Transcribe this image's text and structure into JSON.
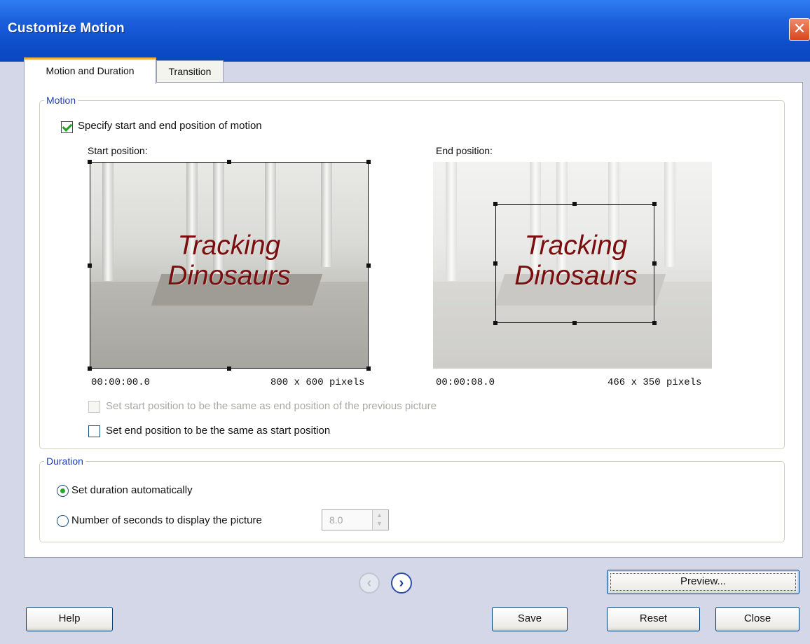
{
  "window": {
    "title": "Customize Motion",
    "close_glyph": "✕"
  },
  "tabs": [
    {
      "label": "Motion and Duration",
      "active": true
    },
    {
      "label": "Transition",
      "active": false
    }
  ],
  "motion": {
    "legend": "Motion",
    "specify_label": "Specify start and end position of motion",
    "specify_checked": true,
    "start": {
      "label": "Start position:",
      "time": "00:00:00.0",
      "size": "800 x 600 pixels",
      "title_line1": "Tracking",
      "title_line2": "Dinosaurs"
    },
    "end": {
      "label": "End position:",
      "time": "00:00:08.0",
      "size": "466 x 350 pixels",
      "title_line1": "Tracking",
      "title_line2": "Dinosaurs"
    },
    "same_as_previous_label": "Set start position to be the same as end position of the previous picture",
    "same_as_previous_checked": false,
    "same_as_previous_enabled": false,
    "end_same_as_start_label": "Set end position to be the same as start position",
    "end_same_as_start_checked": false
  },
  "duration": {
    "legend": "Duration",
    "auto_label": "Set duration automatically",
    "auto_selected": true,
    "seconds_label": "Number of seconds to display the picture",
    "seconds_value": "8.0"
  },
  "nav": {
    "prev_glyph": "‹",
    "next_glyph": "›"
  },
  "buttons": {
    "preview": "Preview...",
    "help": "Help",
    "save": "Save",
    "reset": "Reset",
    "close": "Close"
  },
  "icons": {
    "close": "close-icon",
    "checkbox": "checkbox-icon",
    "radio": "radio-icon",
    "prev": "chevron-left-icon",
    "next": "chevron-right-icon",
    "spin_up": "spin-up-icon",
    "spin_down": "spin-down-icon"
  },
  "colors": {
    "title_bar": "#0f4ecb",
    "dialog_background": "#d4d7e8",
    "group_legend": "#1f3fb8",
    "check_mark": "#21a121",
    "picture_text": "#7a0d0d",
    "active_tab_accent": "#f0b040",
    "close_button": "#d8461e"
  }
}
